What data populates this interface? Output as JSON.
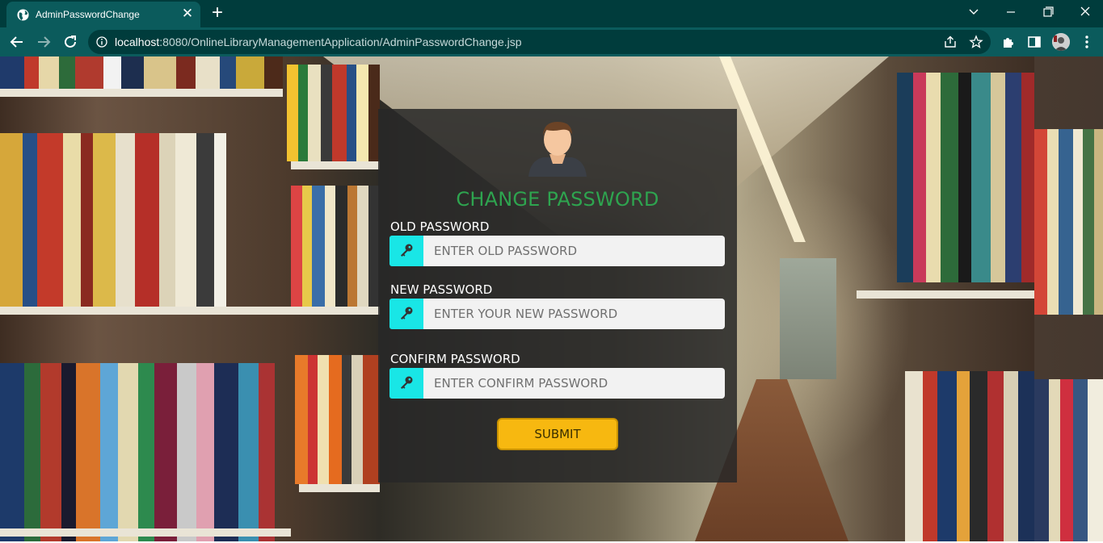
{
  "browser": {
    "tab_title": "AdminPasswordChange",
    "url_host": "localhost",
    "url_rest": ":8080/OnlineLibraryManagementApplication/AdminPasswordChange.jsp",
    "icons": [
      "globe-icon",
      "close-icon",
      "plus-icon",
      "chevron-down-icon",
      "minimize-icon",
      "restore-icon",
      "window-close-icon",
      "back-icon",
      "forward-icon",
      "reload-icon",
      "info-icon",
      "share-icon",
      "star-icon",
      "extensions-icon",
      "sidepanel-icon",
      "profile-avatar",
      "more-icon"
    ]
  },
  "form": {
    "title": "CHANGE PASSWORD",
    "old_label": "OLD PASSWORD",
    "old_placeholder": "ENTER OLD PASSWORD",
    "new_label": "NEW PASSWORD",
    "new_placeholder": "ENTER YOUR NEW PASSWORD",
    "confirm_label": "CONFIRM PASSWORD",
    "confirm_placeholder": "ENTER CONFIRM PASSWORD",
    "submit_label": "SUBMIT"
  },
  "colors": {
    "chrome_dark": "#003c3c",
    "chrome_light": "#0b5b5c",
    "title_green": "#2ea44f",
    "key_cyan": "#19e6e6",
    "submit_yellow": "#f7b810"
  }
}
